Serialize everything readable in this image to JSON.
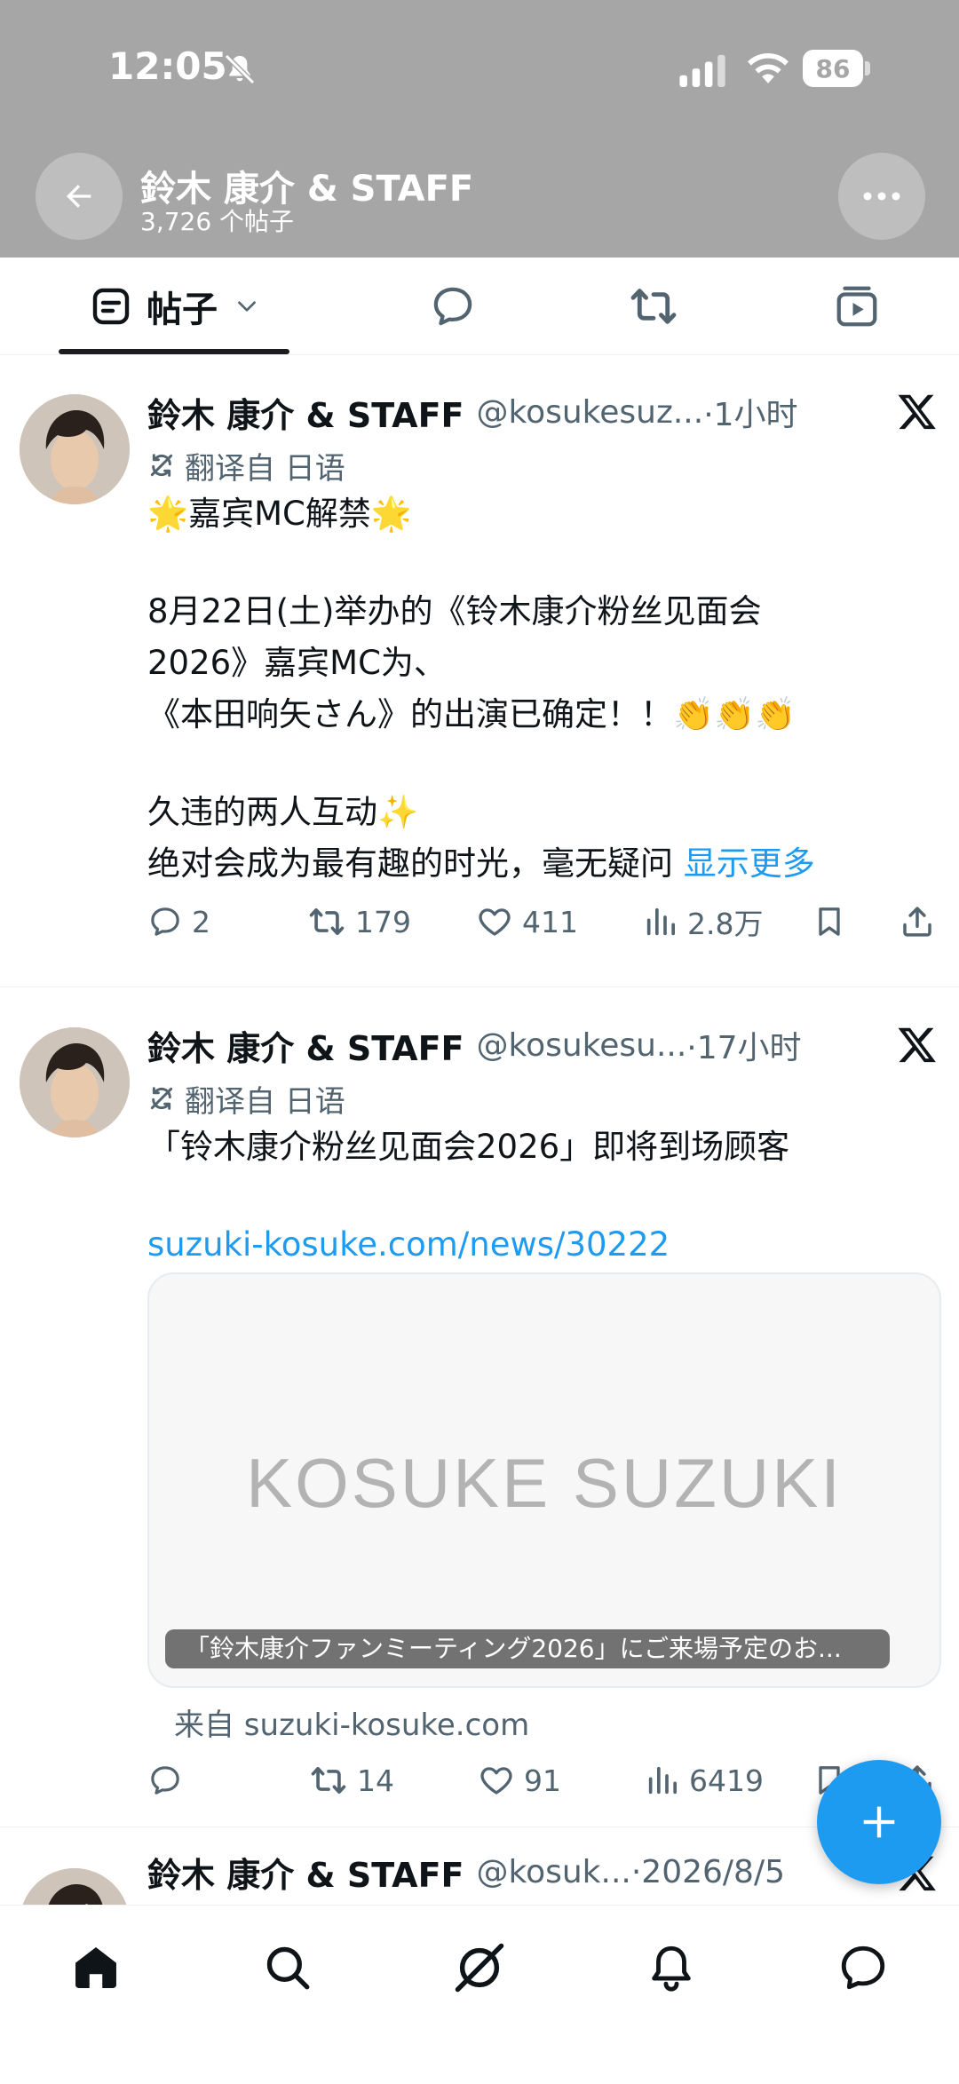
{
  "status_bar": {
    "time": "12:05",
    "battery": "86",
    "icons": [
      "bell-off-icon",
      "signal-icon",
      "wifi-icon",
      "battery-icon"
    ]
  },
  "header": {
    "title": "鈴木 康介 & STAFF",
    "subtitle": "3,726 个帖子",
    "back_icon": "arrow-left-icon",
    "more_icon": "more-horizontal-icon",
    "background": "#a6a6a6"
  },
  "tabs": {
    "posts_label": "帖子",
    "posts_icon": "posts-icon",
    "items": [
      "posts-icon",
      "replies-icon",
      "reposts-icon",
      "media-icon"
    ]
  },
  "posts": [
    {
      "author": "鈴木 康介 & STAFF",
      "handle": "@kosukesuz...",
      "time": "·1小时",
      "translated": "翻译自 日语",
      "lines": [
        "🌟嘉宾MC解禁🌟",
        "",
        "8月22日(土)举办的《铃木康介粉丝见面会",
        "2026》嘉宾MC为、",
        "《本田响矢さん》的出演已确定！！👏👏👏",
        "",
        "久违的两人互动✨",
        "绝对会成为最有趣的时光，毫无疑问"
      ],
      "show_more": "显示更多",
      "replies": "2",
      "reposts": "179",
      "likes": "411",
      "views": "2.8万"
    },
    {
      "author": "鈴木 康介 & STAFF",
      "handle": "@kosukesu...",
      "time": "·17小时",
      "translated": "翻译自 日语",
      "text": "「铃木康介粉丝见面会2026」即将到场顾客",
      "link": "suzuki-kosuke.com/news/30222",
      "card_logo": "KOSUKE SUZUKI",
      "card_caption": "「鈴木康介ファンミーティング2026」にご来場予定のお...",
      "card_source": "来自 suzuki-kosuke.com",
      "replies": "",
      "reposts": "14",
      "likes": "91",
      "views": "6419"
    },
    {
      "author": "鈴木 康介 & STAFF",
      "handle": "@kosuk...",
      "time": "·2026/8/5"
    }
  ],
  "fab": {
    "icon": "plus-icon",
    "color": "#1d9bf0"
  },
  "bottom_nav": [
    "home-icon",
    "search-icon",
    "grok-icon",
    "notifications-icon",
    "messages-icon"
  ]
}
